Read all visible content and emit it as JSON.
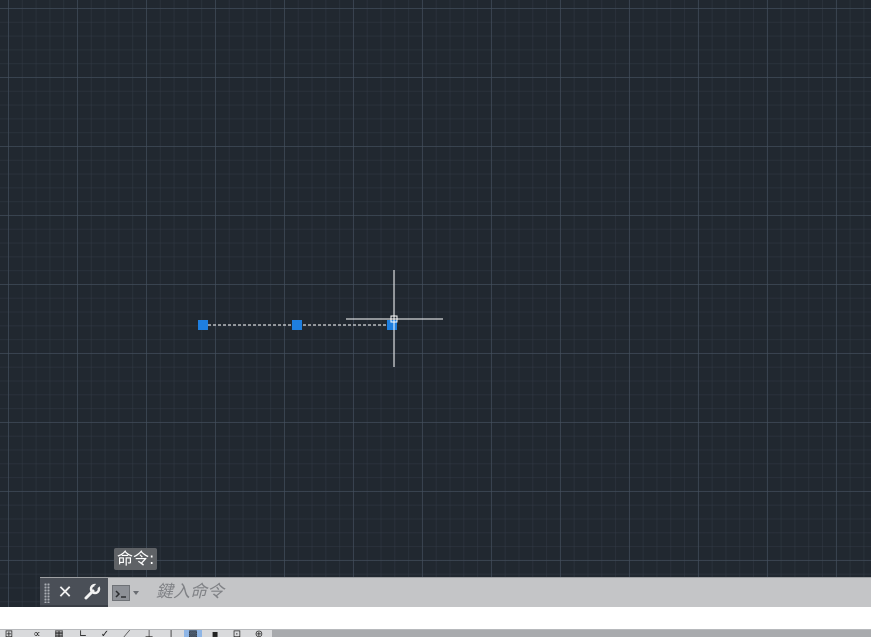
{
  "command_line": {
    "history_text": "命令:",
    "input_placeholder": "鍵入命令",
    "input_value": "",
    "close_icon": "close-icon",
    "customize_icon": "wrench-icon",
    "prompt_icon": "command-prompt-icon"
  },
  "drawing": {
    "background_color": "#212830",
    "grip_color": "#1e7fe0",
    "crosshair_color": "#ffffff",
    "dashed_line_color": "#ffffff",
    "grips": 3
  },
  "status_bar": {
    "icons": [
      "model-space-icon",
      "snap-mode-icon",
      "grid-display-icon",
      "ortho-mode-icon",
      "polar-tracking-icon",
      "isometric-drafting-icon",
      "object-snap-tracking-icon",
      "object-snap-icon",
      "lineweight-icon",
      "transparency-icon",
      "selection-cycling-icon",
      "annotation-scale-icon",
      "workspace-switch-icon"
    ],
    "active_icon": "transparency-icon"
  }
}
